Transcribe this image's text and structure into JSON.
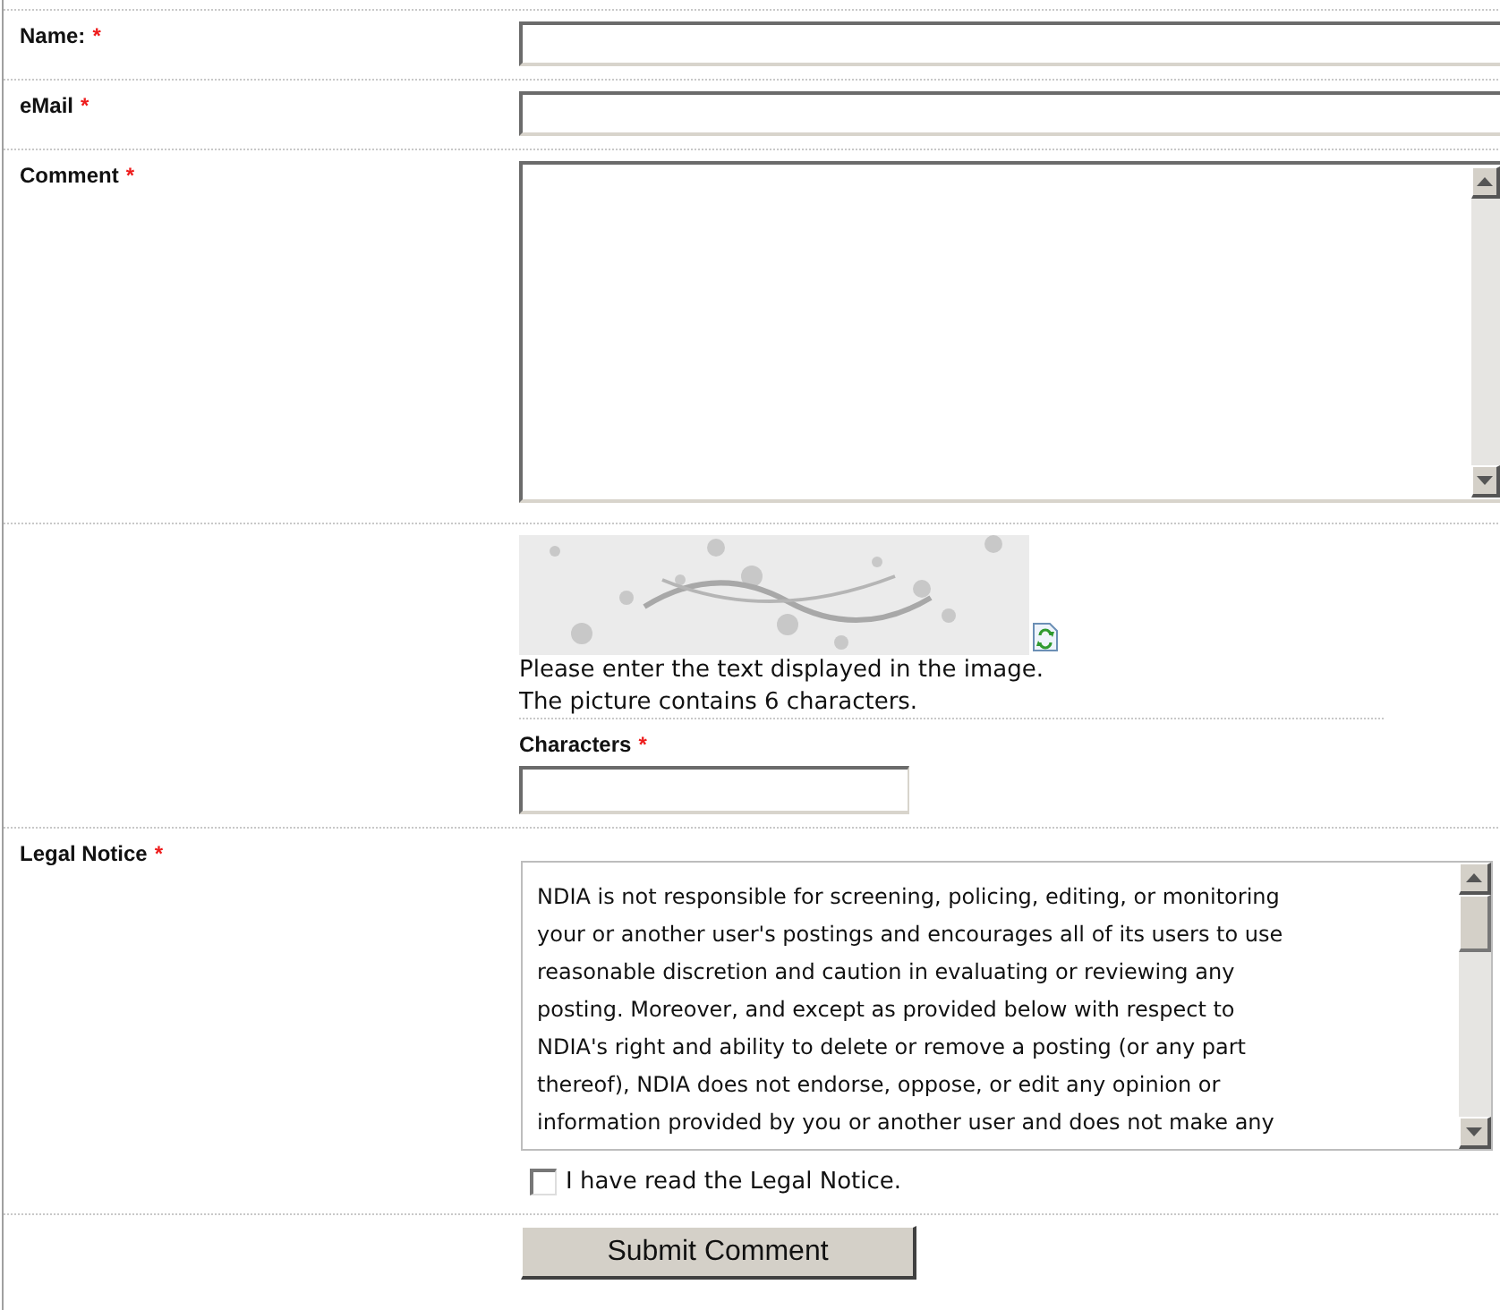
{
  "fields": [
    {
      "kind": "text",
      "label": "Name:",
      "mark": "*"
    },
    {
      "kind": "text",
      "label": "eMail",
      "mark": "*"
    },
    {
      "kind": "textarea",
      "label": "Comment",
      "mark": "*"
    }
  ],
  "captcha": {
    "image": {
      "kind": "picture"
    },
    "instructions": [
      "Please enter the text displayed in the image.",
      "The picture contains 6 characters."
    ],
    "field": {
      "label": "Characters",
      "mark": "*"
    }
  },
  "legal": {
    "label": "Legal Notice",
    "mark": "*",
    "lines": [
      "NDIA is not responsible for screening, policing, editing, or monitoring",
      "your or another user's postings and encourages all of its users to use",
      "reasonable discretion and caution in evaluating or reviewing any",
      "posting. Moreover, and except as provided below with respect to",
      "NDIA's right and ability to delete or remove a posting (or any part",
      "thereof), NDIA does not endorse, oppose, or edit any opinion or",
      "information provided by you or another user and does not make any"
    ],
    "agree": {
      "label": "I have read the Legal Notice.",
      "checked": false
    }
  },
  "submit": "Submit Comment"
}
